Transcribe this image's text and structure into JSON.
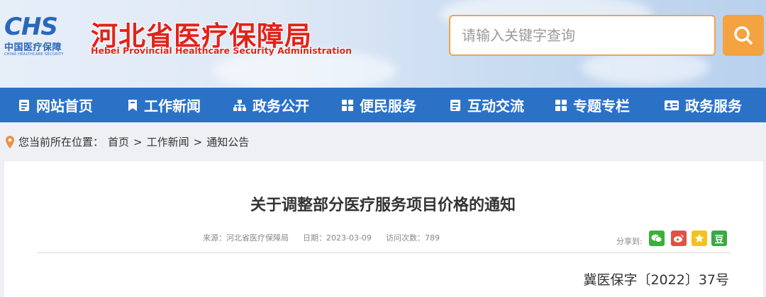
{
  "header": {
    "logo": {
      "mark": "CHS",
      "cn": "中国医疗保障",
      "en": "CHINA HEALTHCARE SECURITY"
    },
    "title": "河北省医疗保障局",
    "subtitle": "Hebei Provincial Healthcare Security Administration",
    "search": {
      "placeholder": "请输入关键字查询",
      "value": ""
    }
  },
  "nav": {
    "items": [
      {
        "label": "网站首页",
        "icon": "document-icon"
      },
      {
        "label": "工作新闻",
        "icon": "bookmark-icon"
      },
      {
        "label": "政务公开",
        "icon": "sitemap-icon"
      },
      {
        "label": "便民服务",
        "icon": "grid-icon"
      },
      {
        "label": "互动交流",
        "icon": "document-icon"
      },
      {
        "label": "专题专栏",
        "icon": "grid-icon"
      },
      {
        "label": "政务服务",
        "icon": "id-card-icon"
      }
    ]
  },
  "breadcrumb": {
    "prefix": "您当前所在位置：",
    "items": [
      "首页",
      "工作新闻",
      "通知公告"
    ],
    "separator": ">"
  },
  "article": {
    "title": "关于调整部分医疗服务项目价格的通知",
    "source_label": "来源：",
    "source": "河北省医疗保障局",
    "date_label": "日期：",
    "date": "2023-03-09",
    "views_label": "访问次数：",
    "views": "789",
    "share_label": "分享到:",
    "share": [
      {
        "name": "wechat",
        "color": "#3bb03b",
        "glyph": "●"
      },
      {
        "name": "weibo",
        "color": "#e05244",
        "glyph": "◉"
      },
      {
        "name": "qzone",
        "color": "#f0c419",
        "glyph": "★"
      },
      {
        "name": "douban",
        "color": "#3aa845",
        "glyph": "豆"
      }
    ],
    "doc_number": "冀医保字〔2022〕37号"
  },
  "colors": {
    "nav_bg": "#2b72c7",
    "accent_orange": "#f5a340",
    "title_red": "#e2231a"
  }
}
